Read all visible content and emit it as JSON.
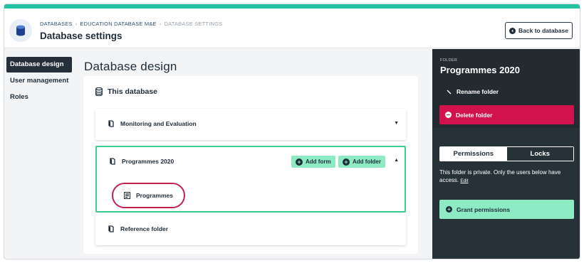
{
  "header": {
    "breadcrumbs": [
      "DATABASES",
      "EDUCATION DATABASE M&E",
      "DATABASE SETTINGS"
    ],
    "title": "Database settings",
    "back_button": "Back to database"
  },
  "sidebar": {
    "items": [
      {
        "label": "Database design",
        "active": true
      },
      {
        "label": "User management",
        "active": false
      },
      {
        "label": "Roles",
        "active": false
      }
    ]
  },
  "main": {
    "title": "Database design",
    "card_title": "This database",
    "folders": [
      {
        "name": "Monitoring and Evaluation",
        "expanded": false
      },
      {
        "name": "Programmes 2020",
        "expanded": true,
        "actions": [
          "Add form",
          "Add folder"
        ],
        "forms": [
          "Programmes"
        ]
      },
      {
        "name": "Reference folder",
        "expanded": false
      }
    ]
  },
  "panel": {
    "label": "FOLDER",
    "title": "Programmes 2020",
    "rename": "Rename folder",
    "delete": "Delete folder",
    "tabs": [
      "Permissions",
      "Locks"
    ],
    "private_text": "This folder is private. Only the users below have access.",
    "edit_link": "Edit",
    "grant": "Grant permissions"
  },
  "colors": {
    "accent": "#23c2a2",
    "mint": "#8debc4",
    "danger": "#d2124c",
    "panel": "#263238",
    "highlight_ring": "#c0224f"
  }
}
